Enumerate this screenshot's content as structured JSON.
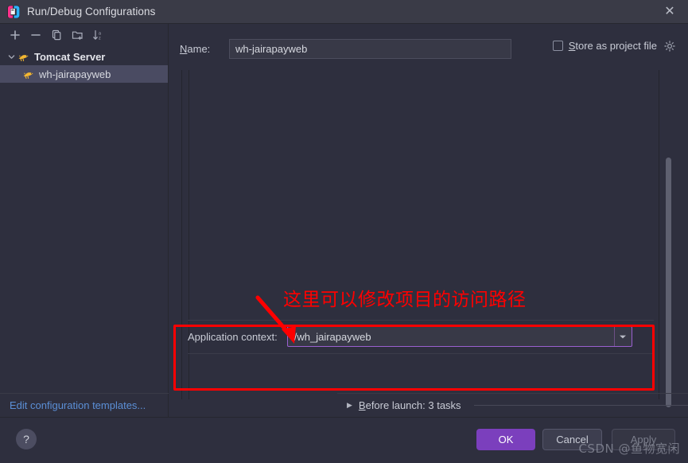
{
  "window": {
    "title": "Run/Debug Configurations",
    "app_icon": "intellij-idea-icon",
    "close_label": "✕"
  },
  "toolbar": {
    "buttons": [
      {
        "name": "add-configuration-button",
        "icon": "plus-icon",
        "label": "+"
      },
      {
        "name": "remove-configuration-button",
        "icon": "minus-icon",
        "label": "−"
      },
      {
        "name": "copy-configuration-button",
        "icon": "copy-icon",
        "label": ""
      },
      {
        "name": "new-folder-button",
        "icon": "new-folder-icon",
        "label": ""
      },
      {
        "name": "sort-configurations-button",
        "icon": "sort-alphabetical-icon",
        "label": ""
      }
    ]
  },
  "tree": {
    "items": [
      {
        "label": "Tomcat Server",
        "icon": "tomcat-icon",
        "expanded": true,
        "selected": false,
        "level": 0,
        "chevron": "⌄"
      },
      {
        "label": "wh-jairapayweb",
        "icon": "tomcat-icon",
        "expanded": false,
        "selected": true,
        "level": 1,
        "chevron": ""
      }
    ]
  },
  "edit_templates": {
    "label": "Edit configuration templates..."
  },
  "name_row": {
    "label": "Name:",
    "mnemonic": "N",
    "value": "wh-jairapayweb",
    "placeholder": "Name"
  },
  "store_as_project_file": {
    "label": "Store as project file",
    "mnemonic": "S",
    "checked": false,
    "gear_icon": "gear-icon"
  },
  "application_context": {
    "label": "Application context:",
    "value": "/wh_jairapayweb",
    "placeholder": "/context",
    "dropdown_arrow": "▼"
  },
  "before_launch": {
    "triangle": "▶",
    "label": "Before launch: 3 tasks",
    "mnemonic": "B"
  },
  "footer": {
    "help_label": "?",
    "ok_label": "OK",
    "cancel_label": "Cancel",
    "apply_label": "Apply",
    "apply_disabled": true
  },
  "annotations": {
    "text": "这里可以修改项目的访问路径",
    "color": "#ff0000",
    "arrow": "red-arrow-icon",
    "rectangle": "red-highlight-rectangle"
  },
  "watermark": {
    "text": "CSDN @鱼物宽闲"
  },
  "scrollbar": {
    "name": "vertical-scrollbar",
    "thumb_position_pct": 27,
    "thumb_size_pct": 76
  },
  "colors": {
    "accent": "#7b3fbd",
    "window_bg": "#2e2f3e",
    "titlebar_bg": "#3a3b47",
    "link": "#5b8fd6",
    "annotation_red": "#ff0000",
    "combo_border": "#9a60d0"
  }
}
